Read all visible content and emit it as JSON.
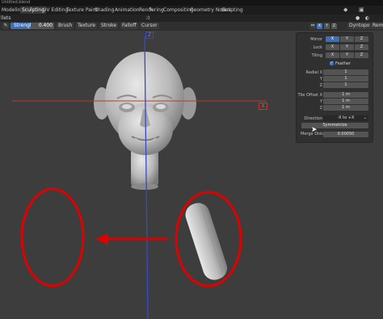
{
  "window": {
    "title": "Untitled.blend"
  },
  "tabs": [
    {
      "label": "Modeling",
      "active": false
    },
    {
      "label": "Sculpting",
      "active": true
    },
    {
      "label": "UV Editing",
      "active": false
    },
    {
      "label": "Texture Paint",
      "active": false
    },
    {
      "label": "Shading",
      "active": false
    },
    {
      "label": "Animation",
      "active": false
    },
    {
      "label": "Rendering",
      "active": false
    },
    {
      "label": "Compositing",
      "active": false
    },
    {
      "label": "Geometry Nodes",
      "active": false
    },
    {
      "label": "Scripting",
      "active": false
    }
  ],
  "toolbar": {
    "menu_label": "llets"
  },
  "tool_settings": {
    "strength_label": "Strength",
    "strength_value": "0.400",
    "brush": "Brush",
    "texture": "Texture",
    "stroke": "Stroke",
    "falloff": "Falloff",
    "cursor": "Cursor",
    "dyntopo": "Dyntopo",
    "remesh": "Reme"
  },
  "axis_buttons": {
    "x": "X",
    "y": "Y",
    "z": "Z"
  },
  "symmetry_panel": {
    "mirror": {
      "label": "Mirror",
      "x": "X",
      "y": "Y",
      "z": "Z"
    },
    "lock": {
      "label": "Lock",
      "x": "X",
      "y": "Y",
      "z": "Z"
    },
    "tiling": {
      "label": "Tiling",
      "x": "X",
      "y": "Y",
      "z": "Z"
    },
    "feather_label": "Feather",
    "radial": {
      "label": "Radial X",
      "x": "1",
      "y_label": "Y",
      "y": "1",
      "z_label": "Z",
      "z": "1"
    },
    "tile_offset": {
      "label": "Tile Offset X",
      "x": "1 m",
      "y_label": "Y",
      "y": "1 m",
      "z_label": "Z",
      "z": "1 m"
    },
    "direction": {
      "label": "Direction",
      "value": "-X to +X"
    },
    "symmetrize_label": "Symmetrize",
    "merge_distance": {
      "label": "Merge Dista...",
      "value": "0.00050"
    }
  },
  "gizmo": {
    "x_label": "X",
    "z_label": "Z"
  },
  "colors": {
    "accent": "#3b6fb7",
    "annotation": "#e00000",
    "axis_x": "#c0392b",
    "axis_z": "#3a48c8"
  }
}
